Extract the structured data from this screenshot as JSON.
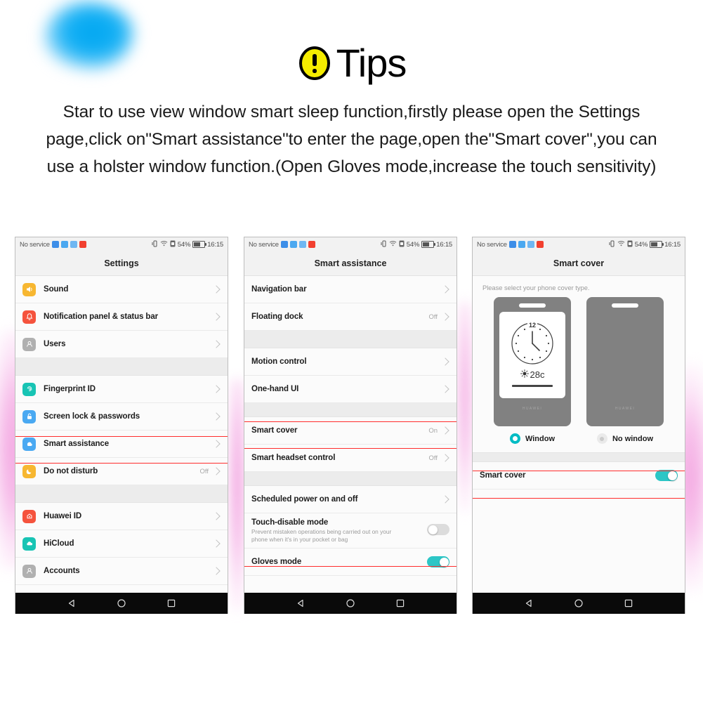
{
  "header": {
    "icon": "warning-exclamation-icon",
    "title": "Tips",
    "body": "Star to use view window smart sleep function,firstly please open the Settings page,click on\"Smart assistance\"to enter the page,open the\"Smart cover\",you can use a holster window function.(Open Gloves mode,increase the touch sensitivity)"
  },
  "colors": {
    "accent_teal": "#2cc6c6",
    "radio_teal": "#00bcc4",
    "highlight_red": "#ff2d2d",
    "tips_yellow": "#f5ec00",
    "blob_blue": "#14b0f5",
    "blob_pink": "#f3a8e2"
  },
  "status_bar": {
    "carrier": "No service",
    "chips": [
      "blue-badge",
      "blue-badge",
      "blue-badge",
      "red-badge"
    ],
    "vibrate_icon": "vibrate-icon",
    "wifi_icon": "wifi-icon",
    "sim_icon": "sim-icon",
    "battery_percent": "54%",
    "battery_icon": "battery-icon",
    "time": "16:15"
  },
  "nav_bar": {
    "back": "back-triangle-icon",
    "home": "home-circle-icon",
    "recents": "recents-square-icon"
  },
  "phone1": {
    "title": "Settings",
    "rows": [
      {
        "label": "Sound",
        "icon": "sound-icon",
        "color": "#f7b731",
        "value": "",
        "chevron": true
      },
      {
        "label": "Notification panel & status bar",
        "icon": "notification-bell-icon",
        "color": "#f5533d",
        "value": "",
        "chevron": true
      },
      {
        "label": "Users",
        "icon": "users-icon",
        "color": "#b0b0b0",
        "value": "",
        "chevron": true
      },
      {
        "label": "Fingerprint ID",
        "icon": "fingerprint-icon",
        "color": "#18c4b4",
        "value": "",
        "chevron": true
      },
      {
        "label": "Screen lock & passwords",
        "icon": "lock-icon",
        "color": "#4aa9f2",
        "value": "",
        "chevron": true
      },
      {
        "label": "Smart assistance",
        "icon": "smart-assistance-icon",
        "color": "#4aa9f2",
        "value": "",
        "chevron": true,
        "highlighted": true
      },
      {
        "label": "Do not disturb",
        "icon": "moon-icon",
        "color": "#f7b731",
        "value": "Off",
        "chevron": true
      },
      {
        "label": "Huawei ID",
        "icon": "huawei-id-icon",
        "color": "#f5533d",
        "value": "",
        "chevron": true
      },
      {
        "label": "HiCloud",
        "icon": "cloud-icon",
        "color": "#18c4b4",
        "value": "",
        "chevron": true
      },
      {
        "label": "Accounts",
        "icon": "accounts-icon",
        "color": "#b0b0b0",
        "value": "",
        "chevron": true
      }
    ]
  },
  "phone2": {
    "title": "Smart assistance",
    "rows": [
      {
        "label": "Navigation bar",
        "value": "",
        "chevron": true
      },
      {
        "label": "Floating dock",
        "value": "Off",
        "chevron": true
      },
      {
        "label": "Motion control",
        "value": "",
        "chevron": true
      },
      {
        "label": "One-hand UI",
        "value": "",
        "chevron": true
      },
      {
        "label": "Smart cover",
        "value": "On",
        "chevron": true,
        "highlighted": true
      },
      {
        "label": "Smart headset control",
        "value": "Off",
        "chevron": true
      },
      {
        "label": "Scheduled power on and off",
        "value": "",
        "chevron": true
      },
      {
        "label": "Touch-disable mode",
        "sub": "Prevent mistaken operations being carried out on your phone when it's in your pocket or bag",
        "toggle": "off"
      },
      {
        "label": "Gloves mode",
        "toggle": "on",
        "highlighted": true
      }
    ]
  },
  "phone3": {
    "title": "Smart cover",
    "hint": "Please select your phone cover type.",
    "cover_brand": "HUAWEI",
    "clock_hour_label": "12",
    "temperature": "28c",
    "weather_icon": "sun-icon",
    "options": [
      {
        "label": "Window",
        "selected": true
      },
      {
        "label": "No window",
        "selected": false
      }
    ],
    "toggle_row": {
      "label": "Smart cover",
      "toggle": "on",
      "highlighted": true
    }
  }
}
